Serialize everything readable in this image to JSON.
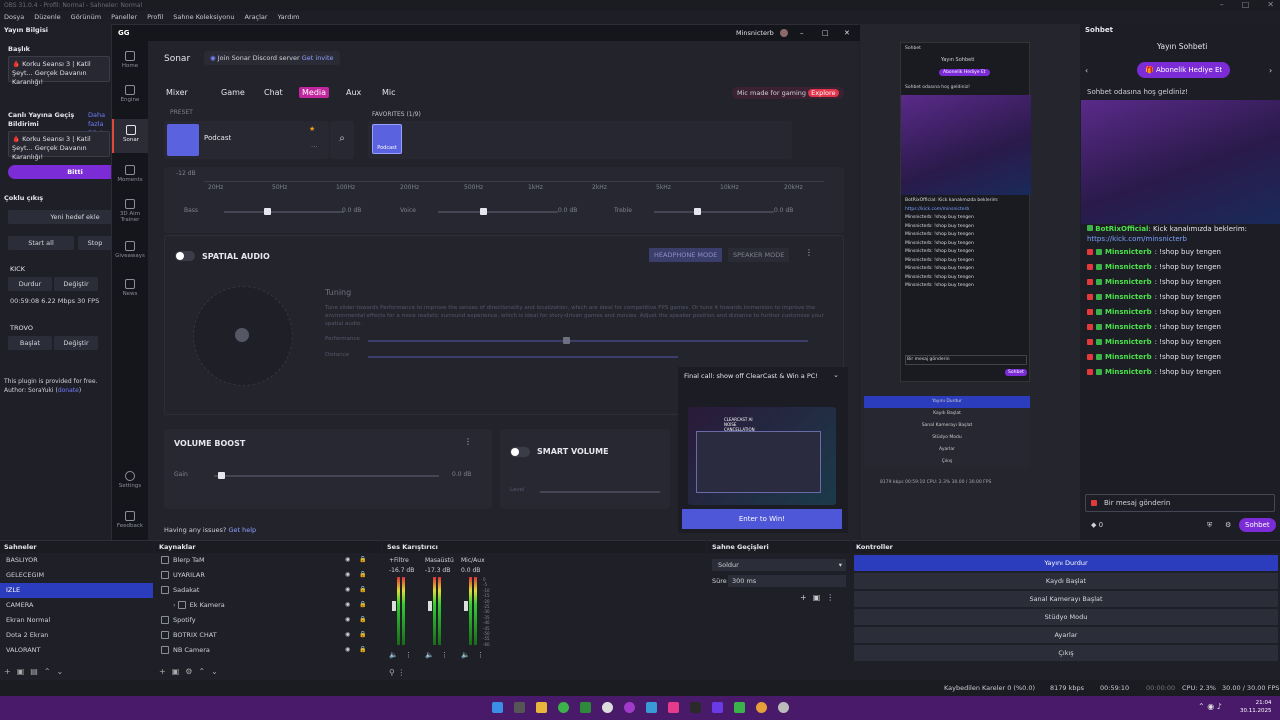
{
  "window": {
    "title": "OBS 31.0.4 - Profil: Normal - Sahneler: Normal"
  },
  "menu": [
    "Dosya",
    "Düzenle",
    "Görünüm",
    "Paneller",
    "Profil",
    "Sahne Koleksiyonu",
    "Araçlar",
    "Yardım"
  ],
  "left": {
    "title_label": "Yayın Bilgisi",
    "baslik": "Başlık",
    "title_text": "🩸 Korku Seansı 3 | Katil Şeyt... Gerçek Davanın Karanlığı!",
    "live_label": "Canlı Yayına Geçiş Bildirimi",
    "more_info": "Daha fazla Bilgi",
    "live_text": "🩸 Korku Seansı 3 | Katil Şeyt... Gerçek Davanın Karanlığı!",
    "bitti": "Bitti",
    "multi_title": "Çoklu çıkış",
    "new_target": "Yeni hedef ekle",
    "start_all": "Start all",
    "stop_all": "Stop",
    "kick": "KICK",
    "kick_stop": "Durdur",
    "kick_change": "Değiştir",
    "kick_stats": "00:59:08  6.22 Mbps  30 FPS",
    "trovo": "TROVO",
    "trovo_start": "Başlat",
    "trovo_change": "Değiştir",
    "plugin_note": "This plugin is provided for free.",
    "author": "Author: SoraYuki (",
    "donate": "donate",
    "author_end": ")"
  },
  "gg": {
    "app": "GG",
    "user": "Minsnicterb",
    "sidebar": [
      "Home",
      "Engine",
      "Sonar",
      "Moments",
      "3D Aim Trainer",
      "Giveaways",
      "News",
      "Settings",
      "Feedback"
    ],
    "sonar_title": "Sonar",
    "discord": "Join Sonar Discord server",
    "get_invite": "Get invite",
    "tabs": [
      "Mixer",
      "Game",
      "Chat",
      "Media",
      "Aux",
      "Mic"
    ],
    "mic_promo": "Mic made for gaming",
    "explore": "Explore",
    "preset_label": "PRESET",
    "preset_name": "Podcast",
    "favorites": "FAVORITES (1/9)",
    "fav_item": "Podcast",
    "eq_db": "-12 dB",
    "freqs": [
      "20Hz",
      "50Hz",
      "100Hz",
      "200Hz",
      "500Hz",
      "1kHz",
      "2kHz",
      "5kHz",
      "10kHz",
      "20kHz"
    ],
    "bass": "Bass",
    "bass_val": "0.0 dB",
    "voice": "Voice",
    "voice_val": "0.0 dB",
    "treble": "Treble",
    "treble_val": "0.0 dB",
    "spatial": "SPATIAL AUDIO",
    "headphone": "HEADPHONE MODE",
    "speaker": "SPEAKER MODE",
    "tuning": "Tuning",
    "tuning_desc": "Tune slider towards Performance to improve the senses of directionality and localization, which are ideal for competitive FPS games. Or tune it towards Immersion to improve the environmental effects for a more realistic surround experience, which is ideal for story-driven games and movies. Adjust the speaker position and distance to further customize your spatial audio.",
    "performance": "Performance",
    "distance": "Distance",
    "volume_boost": "VOLUME BOOST",
    "gain": "Gain",
    "gain_val": "0.0 dB",
    "smart_volume": "SMART VOLUME",
    "level": "Level",
    "issues": "Having any issues?",
    "get_help": "Get help",
    "promo_title": "Final call: show off ClearCast & Win a PC!",
    "promo_img1": "CLEARCAST AI NOISE CANCELLATION",
    "promo_img2": "CREATOR SUBMISSION",
    "enter": "Enter to Win!"
  },
  "preview": {
    "head": "Sohbet",
    "stream_chat": "Yayın Sohbeti",
    "gift": "Abonelik Hediye Et",
    "welcome": "Sohbet odasına hoş geldiniz!",
    "send": "Bir mesaj gönderin",
    "chat_btn": "Sohbet",
    "mini_controls": [
      "Yayını Durdur",
      "Kaydı Başlat",
      "Sanal Kamerayı Başlat",
      "Stüdyo Modu",
      "Ayarlar",
      "Çıkış"
    ],
    "mini_stats": "8179 kbps   00:59:10   CPU: 2.3%   30.00 / 30.00 FPS"
  },
  "chat": {
    "title": "Sohbet",
    "stream_chat": "Yayın Sohbeti",
    "gift": "Abonelik Hediye Et",
    "welcome": "Sohbet odasına hoş geldiniz!",
    "bot_name": "BotRixOfficial",
    "bot_msg": ": Kick kanalımızda beklerim:",
    "bot_link": "https://kick.com/minsnicterb",
    "user": "Minsnicterb",
    "msg": ": !shop buy tengen",
    "count": 9,
    "send": "Bir mesaj gönderin",
    "chat_btn": "Sohbet",
    "counter": "0"
  },
  "scenes": {
    "title": "Sahneler",
    "items": [
      "BASLIYOR",
      "GELECEGIM",
      "IZLE",
      "CAMERA",
      "Ekran Normal",
      "Dota 2 Ekran",
      "VALORANT"
    ],
    "selected": 2
  },
  "sources": {
    "title": "Kaynaklar",
    "items": [
      "Blerp TaM",
      "UYARILAR",
      "Sadakat",
      "Ek Kamera",
      "Spotify",
      "BOTRIX CHAT",
      "NB Camera"
    ]
  },
  "mixer": {
    "title": "Ses Karıştırıcı",
    "channels": [
      {
        "name": "+Filtre",
        "db": "-16.7 dB"
      },
      {
        "name": "Masaüstü",
        "db": "-17.3 dB"
      },
      {
        "name": "Mic/Aux",
        "db": "0.0 dB"
      }
    ],
    "scale": [
      "0",
      "-5",
      "-10",
      "-15",
      "-20",
      "-25",
      "-30",
      "-35",
      "-40",
      "-45",
      "-50",
      "-55",
      "-60"
    ]
  },
  "transitions": {
    "title": "Sahne Geçişleri",
    "type": "Soldur",
    "duration_label": "Süre",
    "duration": "300 ms"
  },
  "controls": {
    "title": "Kontroller",
    "items": [
      "Yayını Durdur",
      "Kaydı Başlat",
      "Sanal Kamerayı Başlat",
      "Stüdyo Modu",
      "Ayarlar",
      "Çıkış"
    ]
  },
  "status": {
    "dropped": "Kaybedilen Kareler 0 (%0.0)",
    "kbps": "8179 kbps",
    "live_time": "00:59:10",
    "rec_time": "00:00:00",
    "cpu": "CPU: 2.3%",
    "fps": "30.00 / 30.00 FPS"
  },
  "taskbar": {
    "time": "21:04",
    "date": "30.11.2025"
  },
  "colors": {
    "accent": "#7b2cd6",
    "obs_blue": "#2b3dbd",
    "sonar_pink": "#c1269e",
    "gg_blue": "#5a62e0"
  }
}
